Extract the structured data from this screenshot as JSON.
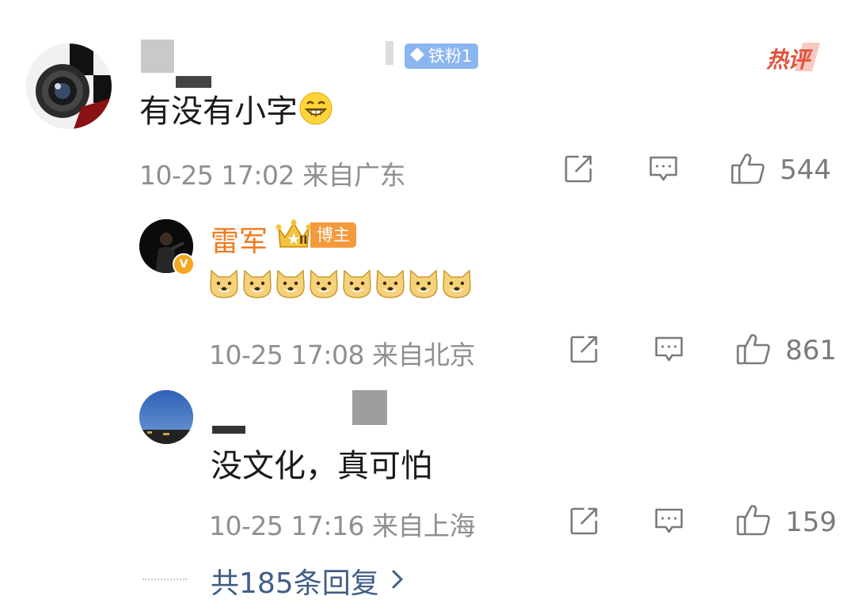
{
  "main_comment": {
    "badge": "铁粉1",
    "hot_tag": "热评",
    "text": "有没有小字",
    "meta": "10-25 17:02 来自广东",
    "likes": "544",
    "emoji": "grinning-face-emoji"
  },
  "replies": [
    {
      "username": "雷军",
      "tag": "博主",
      "crown_level": "II",
      "verified": "V",
      "text_emojis": [
        "doge-emoji",
        "doge-emoji",
        "doge-emoji",
        "doge-emoji",
        "doge-emoji",
        "doge-emoji",
        "doge-emoji",
        "doge-emoji"
      ],
      "meta": "10-25 17:08 来自北京",
      "likes": "861"
    },
    {
      "text": "没文化，真可怕",
      "meta": "10-25 17:16 来自上海",
      "likes": "159"
    }
  ],
  "more_replies": "共185条回复",
  "colors": {
    "username_orange": "#f07a1e",
    "badge_blue": "#8ab5f0",
    "hot_red": "#e2523e",
    "meta_gray": "#8f8f8f",
    "link_blue": "#415e86"
  },
  "icons": [
    "share-icon",
    "comment-icon",
    "like-icon",
    "chevron-right-icon"
  ]
}
